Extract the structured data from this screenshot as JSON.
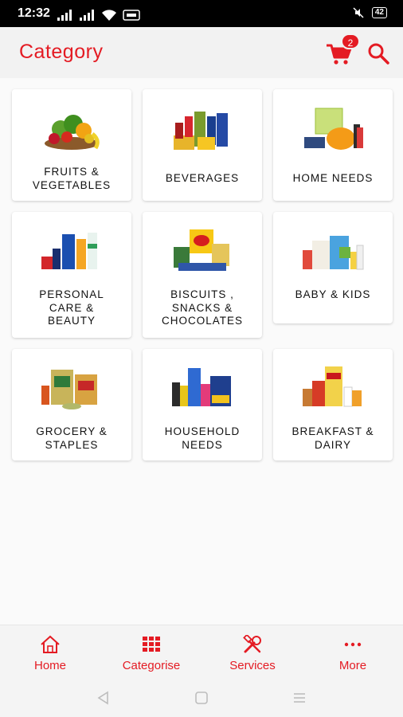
{
  "status_bar": {
    "time": "12:32",
    "battery": "42"
  },
  "header": {
    "title": "Category",
    "cart_count": "2"
  },
  "categories": [
    {
      "label": "FRUITS &\nVEGETABLES"
    },
    {
      "label": "BEVERAGES"
    },
    {
      "label": "HOME NEEDS"
    },
    {
      "label": "PERSONAL\nCARE &\nBEAUTY"
    },
    {
      "label": "BISCUITS ,\nSNACKS &\nCHOCOLATES"
    },
    {
      "label": "BABY & KIDS"
    },
    {
      "label": "GROCERY &\nSTAPLES"
    },
    {
      "label": "HOUSEHOLD\nNEEDS"
    },
    {
      "label": "BREAKFAST &\nDAIRY"
    }
  ],
  "bottom_nav": {
    "items": [
      {
        "label": "Home",
        "icon": "home-icon"
      },
      {
        "label": "Categorise",
        "icon": "grid-icon"
      },
      {
        "label": "Services",
        "icon": "tools-icon"
      },
      {
        "label": "More",
        "icon": "more-icon"
      }
    ]
  },
  "colors": {
    "accent": "#e41b23",
    "header_bg": "#f2f2f2",
    "status_bg": "#000000"
  }
}
